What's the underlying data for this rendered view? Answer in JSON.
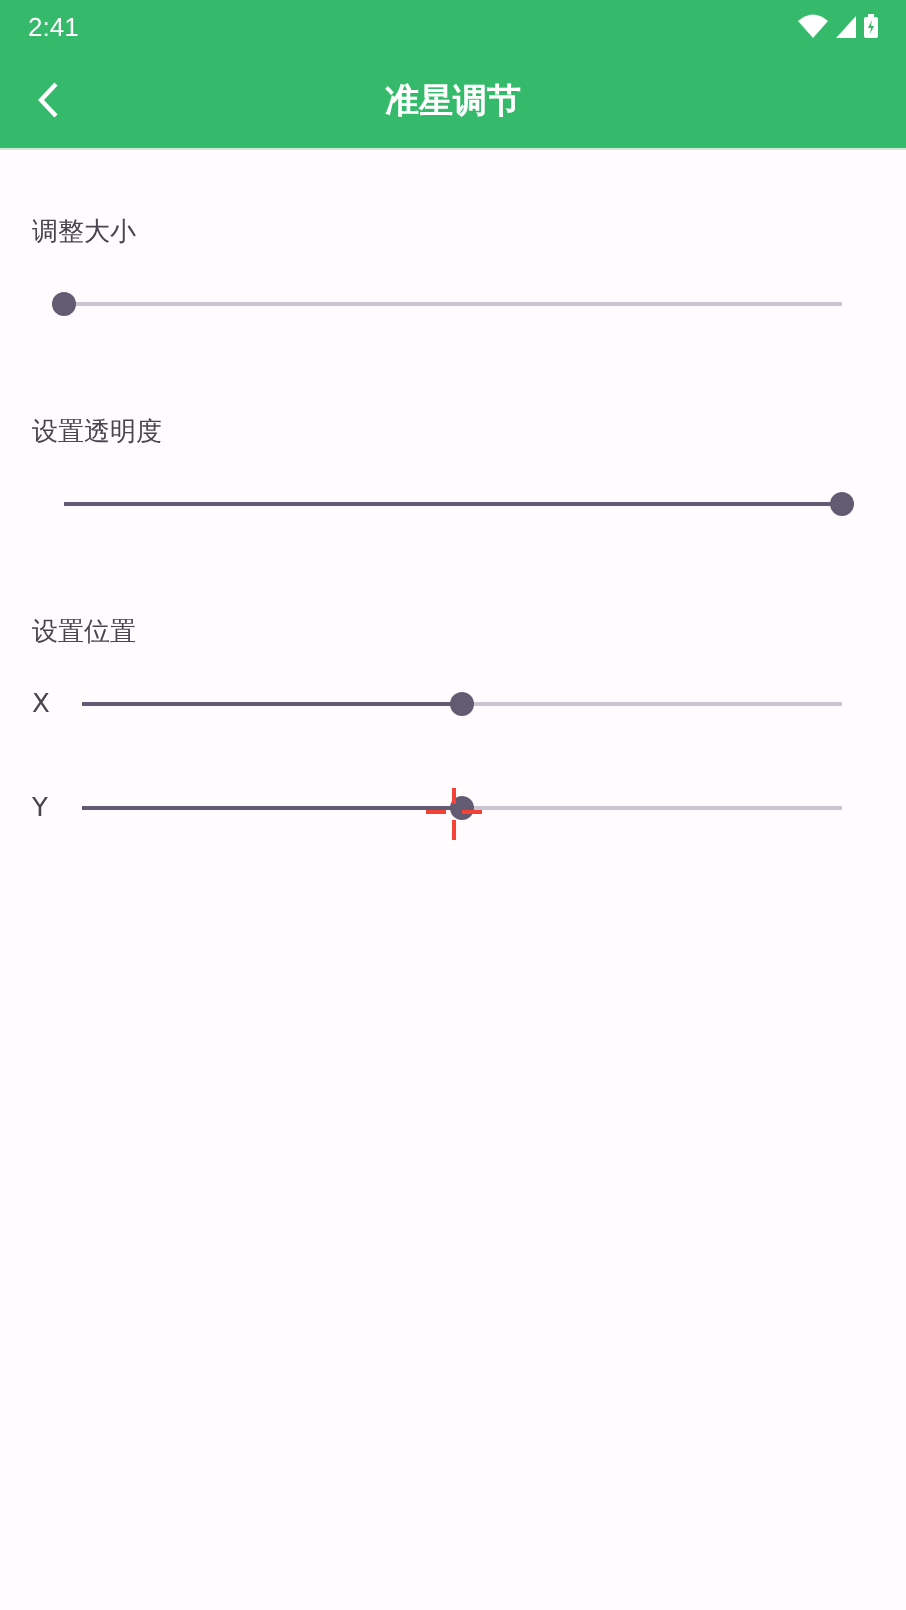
{
  "status_bar": {
    "time": "2:41"
  },
  "app_bar": {
    "title": "准星调节"
  },
  "sections": [
    {
      "label": "调整大小",
      "sliders": [
        {
          "level": 0
        }
      ]
    },
    {
      "label": "设置透明度",
      "sliders": [
        {
          "level": 1
        }
      ]
    },
    {
      "label": "设置位置",
      "sliders": [
        {
          "axis": "X",
          "level": 0.5
        },
        {
          "axis": "Y",
          "level": 0.5
        }
      ]
    }
  ]
}
